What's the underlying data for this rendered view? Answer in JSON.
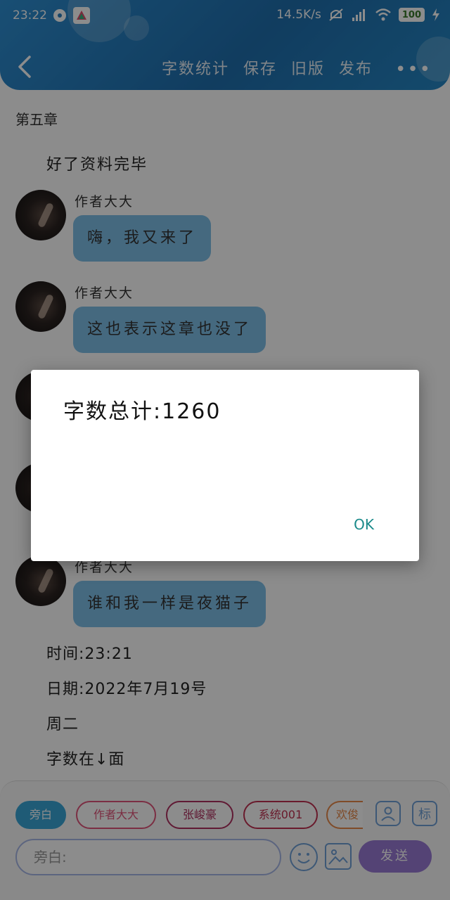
{
  "status_bar": {
    "time": "23:22",
    "network_speed": "14.5K/s",
    "battery": "100"
  },
  "header": {
    "actions": [
      "字数统计",
      "保存",
      "旧版",
      "发布"
    ],
    "more": "•••"
  },
  "content": {
    "chapter": "第五章",
    "intro": "好了资料完毕",
    "messages": [
      {
        "name": "作者大大",
        "text": "嗨，我又来了"
      },
      {
        "name": "作者大大",
        "text": "这也表示这章也没了"
      },
      {
        "name": "作者大大",
        "text": "谁和我一样是夜猫子"
      }
    ],
    "footer_lines": [
      "时间:23:21",
      "日期:2022年7月19号",
      "周二",
      "字数在↓面"
    ]
  },
  "bottom": {
    "roles": [
      "旁白",
      "作者大大",
      "张峻豪",
      "系统001",
      "欢俊"
    ],
    "input_placeholder": "旁白:",
    "send": "发送",
    "mark_icon_label": "标"
  },
  "dialog": {
    "message": "字数总计:1260",
    "ok": "OK"
  },
  "colors": {
    "header": "#1f6fae",
    "bubble": "#7fbfe8",
    "send": "#9a7ad6",
    "dialog_ok": "#1a8a8a"
  }
}
